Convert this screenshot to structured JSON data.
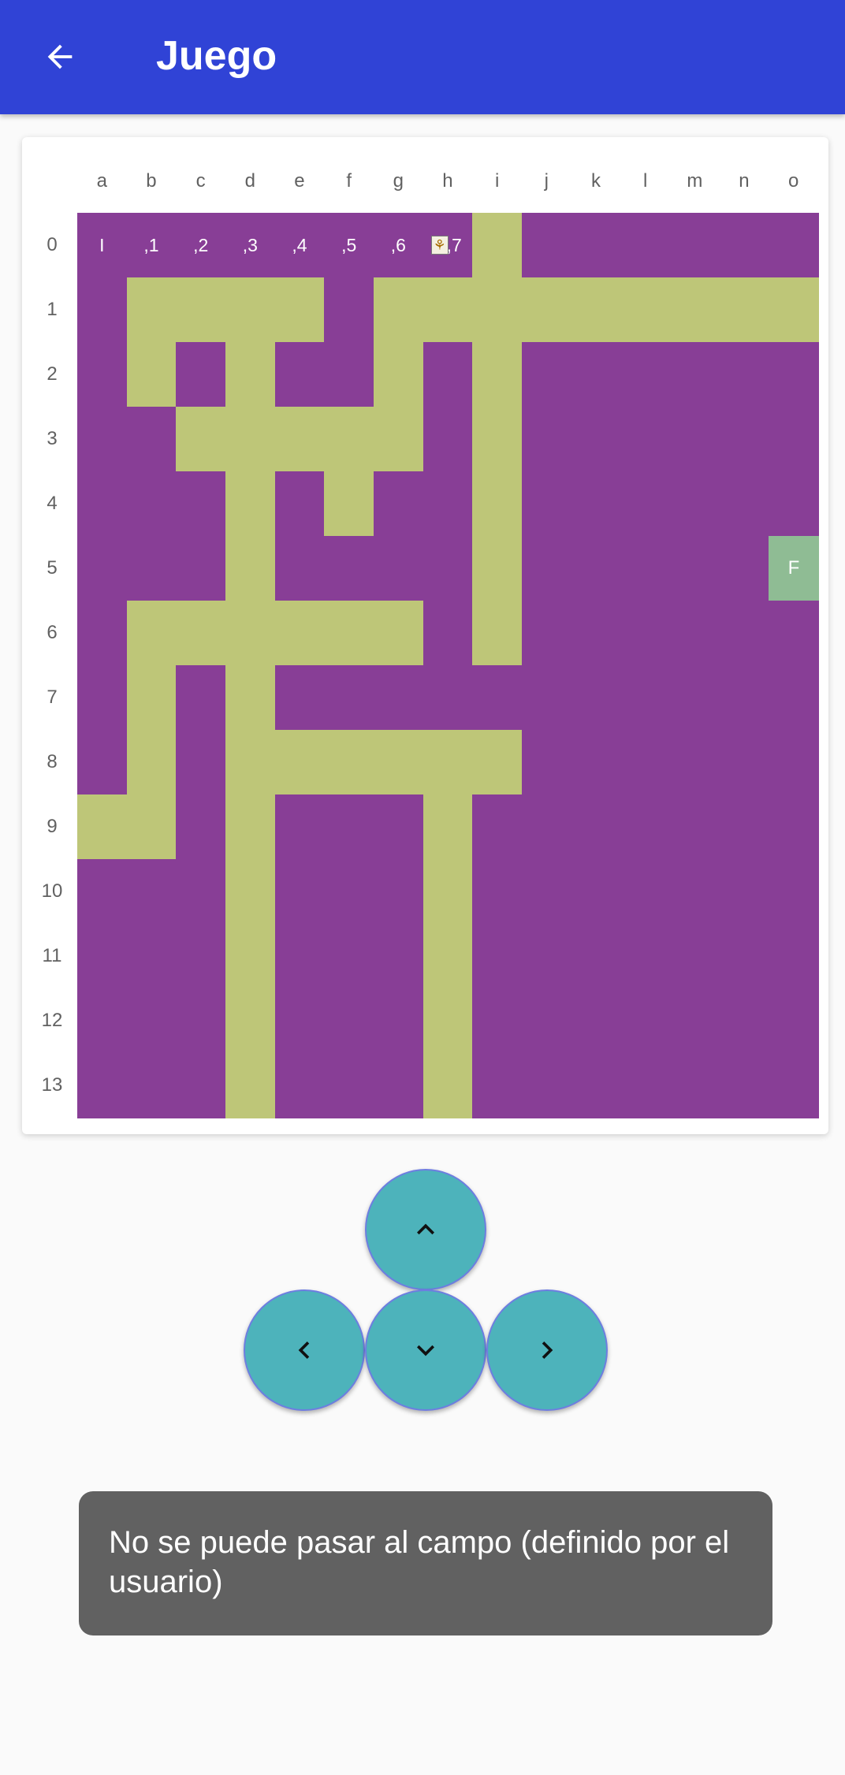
{
  "app_bar": {
    "title": "Juego",
    "back_icon": "arrow-left-icon"
  },
  "board": {
    "columns": [
      "a",
      "b",
      "c",
      "d",
      "e",
      "f",
      "g",
      "h",
      "i",
      "j",
      "k",
      "l",
      "m",
      "n",
      "o"
    ],
    "rows": [
      "0",
      "1",
      "2",
      "3",
      "4",
      "5",
      "6",
      "7",
      "8",
      "9",
      "10",
      "11",
      "12",
      "13"
    ],
    "grid": [
      "WWWWWWWWPWWWWWW",
      "WPPPPWPPPPPPPPP",
      "WPWPWWPWPWWWWWW",
      "WWPPPPPWPWWWWWW",
      "WWWPWPWWPWWWWWW",
      "WWWPWWWWPWWWWWF",
      "WPPPPPPWPWWWWWW",
      "WPWPWWWWWWWWWWW",
      "WPWPPPPPPWWWWWW",
      "PPWPWWWPWWWWWWW",
      "WWWPWWWPWWWWWWW",
      "WWWPWWWPWWWWWWW",
      "WWWPWWWPWWWWWWW",
      "WWWPWWWPWWWWWWW"
    ],
    "row0_labels": [
      "I",
      ",1",
      ",2",
      ",3",
      ",4",
      ",5",
      ",6",
      ",7"
    ],
    "finish_label": "F",
    "player_icon": "bee-icon",
    "colors": {
      "wall": "#883e96",
      "path": "#bec678",
      "finish": "#8fbc94"
    }
  },
  "controls": {
    "up": "chevron-up-icon",
    "left": "chevron-left-icon",
    "down": "chevron-down-icon",
    "right": "chevron-right-icon"
  },
  "toast": {
    "message": "No se puede pasar al campo (definido por el usuario)"
  }
}
